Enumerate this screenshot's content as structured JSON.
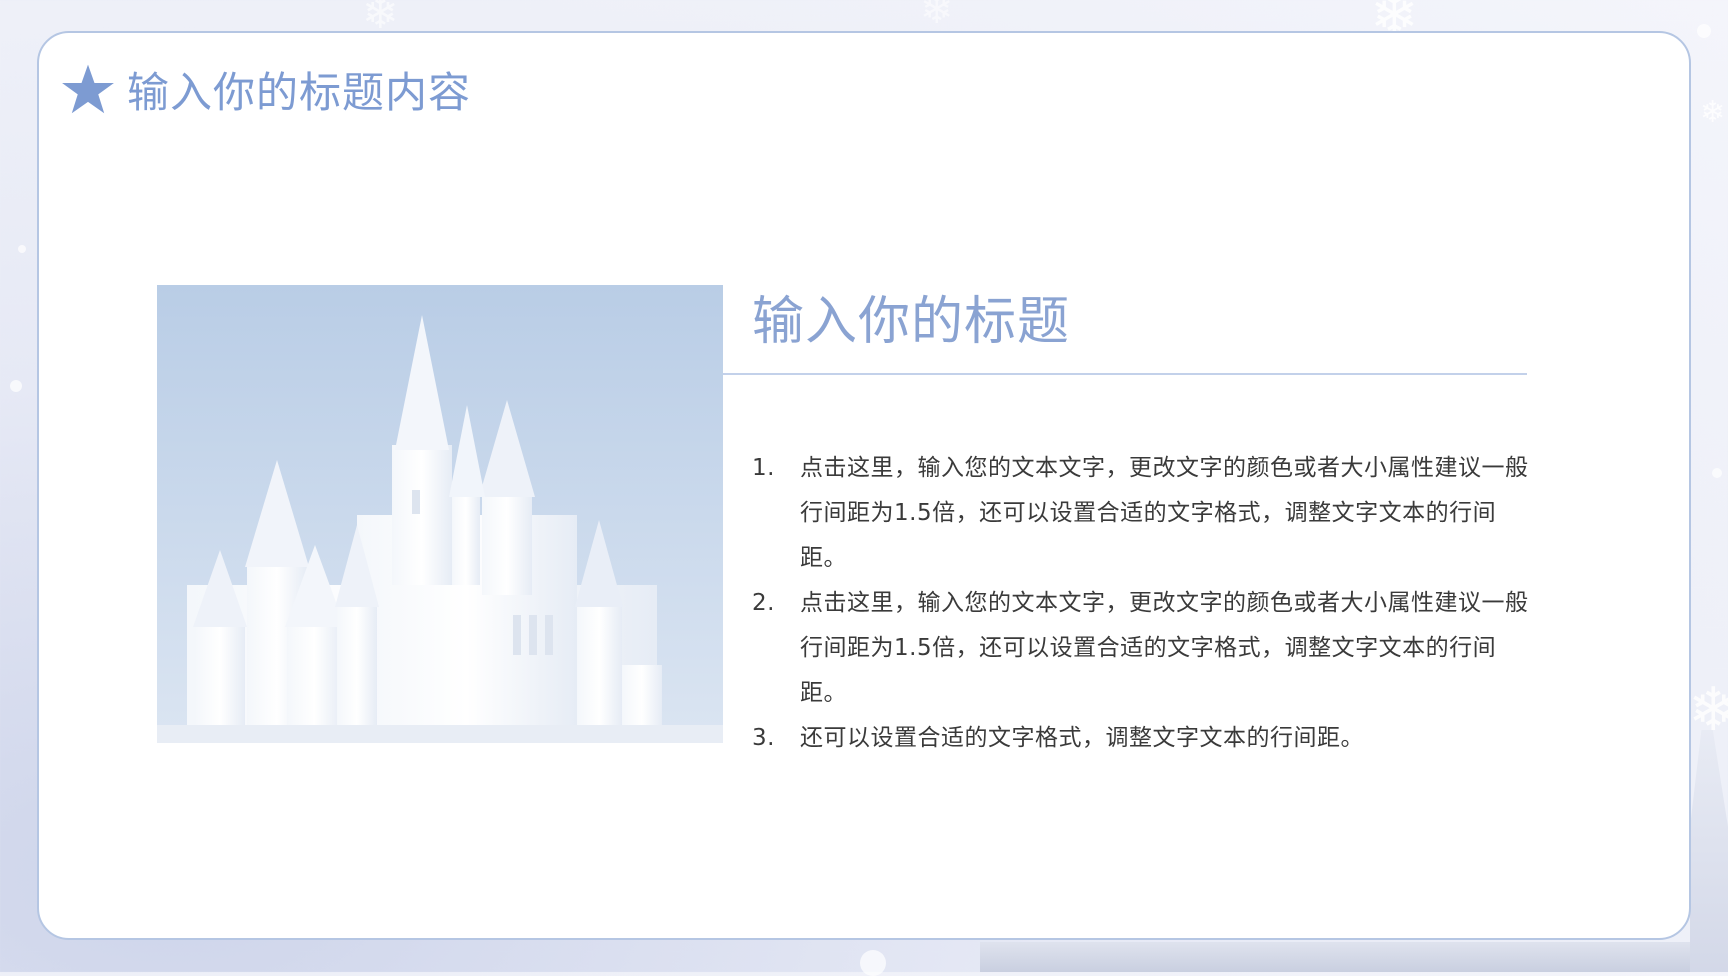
{
  "page": {
    "title": "输入你的标题内容"
  },
  "section": {
    "title": "输入你的标题",
    "items": [
      {
        "number": "1.",
        "text": "点击这里，输入您的文本文字，更改文字的颜色或者大小属性建议一般行间距为1.5倍，还可以设置合适的文字格式，调整文字文本的行间距。"
      },
      {
        "number": "2.",
        "text": "点击这里，输入您的文本文字，更改文字的颜色或者大小属性建议一般行间距为1.5倍，还可以设置合适的文字格式，调整文字文本的行间距。"
      },
      {
        "number": "3.",
        "text": "还可以设置合适的文字格式，调整文字文本的行间距。"
      }
    ]
  },
  "icons": {
    "header": "star-icon",
    "decor": "snowflake-icon"
  },
  "colors": {
    "accent": "#7d9bd2",
    "border": "#b5c6e3",
    "body_text": "#3a3a3a"
  }
}
